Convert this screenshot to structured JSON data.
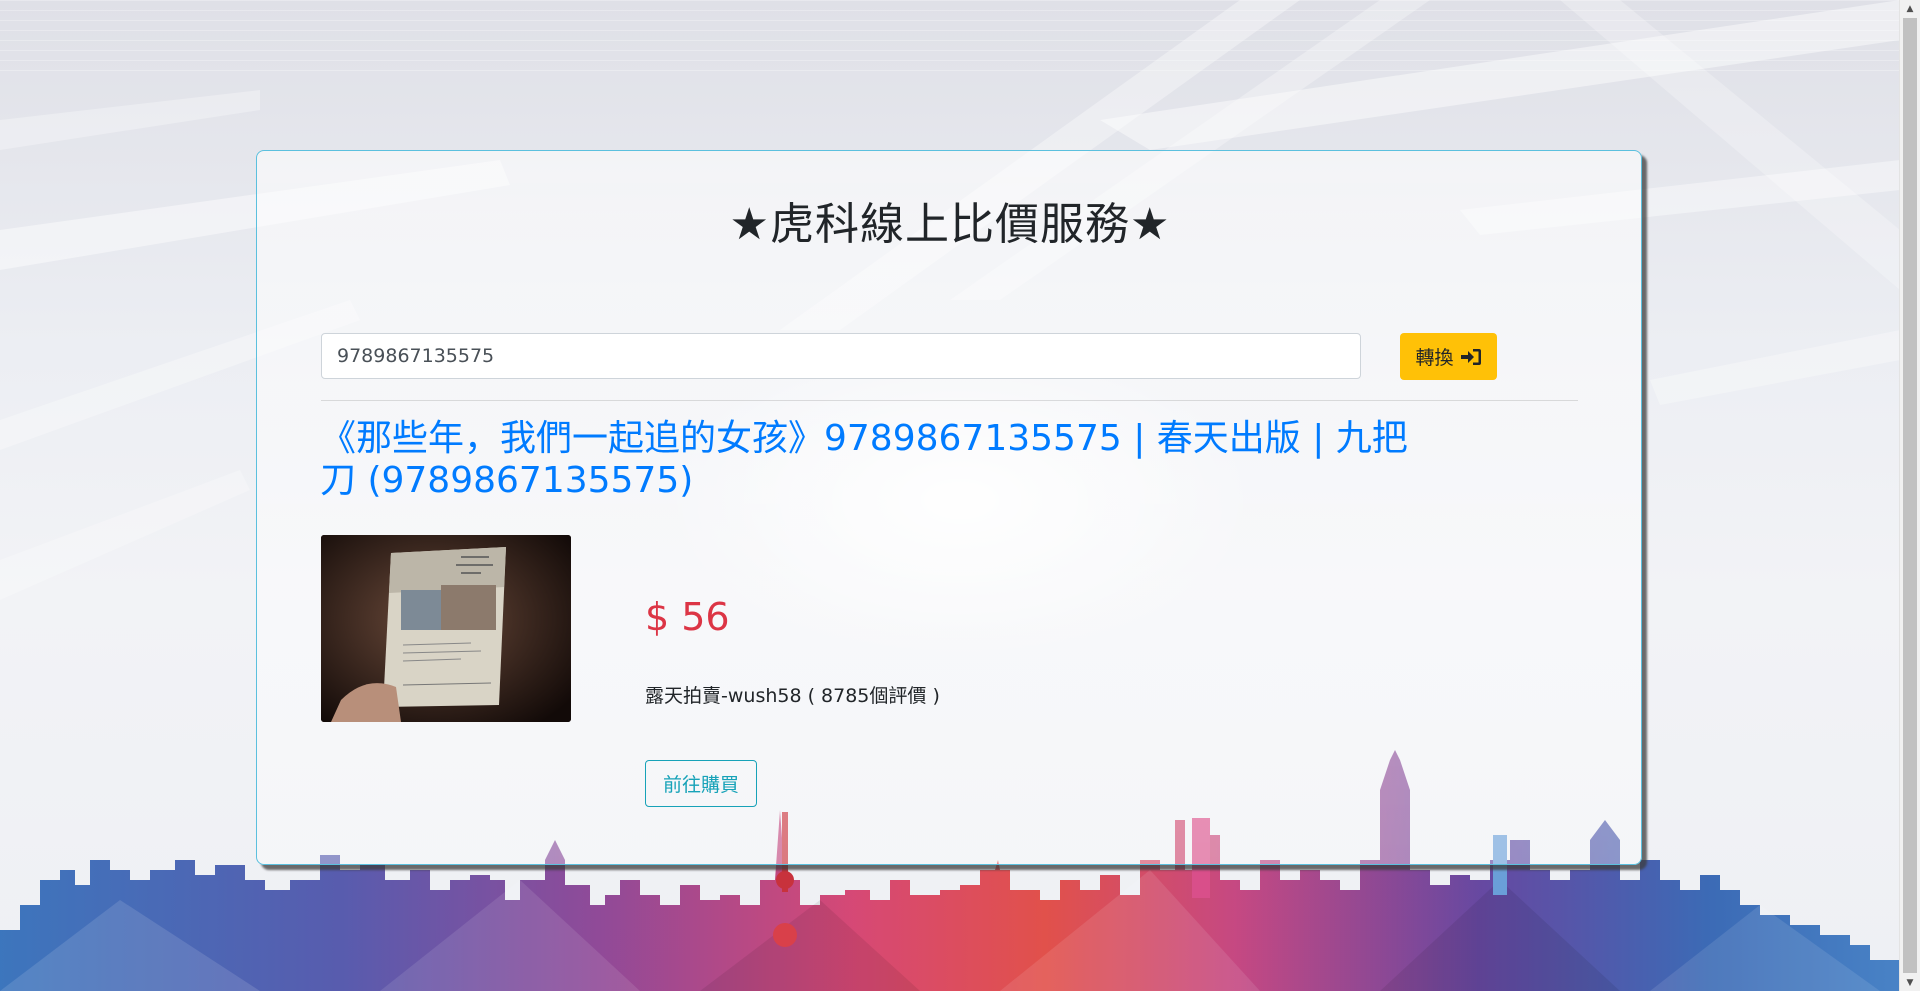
{
  "page": {
    "title": "★虎科線上比價服務★"
  },
  "search": {
    "value": "9789867135575",
    "placeholder": ""
  },
  "convert_button": {
    "label": "轉換",
    "icon": "sign-in-icon",
    "color": "#ffc107"
  },
  "result": {
    "title": "《那些年，我們一起追的女孩》9789867135575 | 春天出版 | 九把刀 (9789867135575)",
    "price": "$ 56",
    "seller": "露天拍賣-wush58 ( 8785個評價 )",
    "buy_label": "前往購買",
    "image_alt": "book-photo"
  },
  "colors": {
    "link": "#007bff",
    "price": "#dc3545",
    "card_border": "#5bc0de",
    "buy_outline": "#17a2b8"
  }
}
